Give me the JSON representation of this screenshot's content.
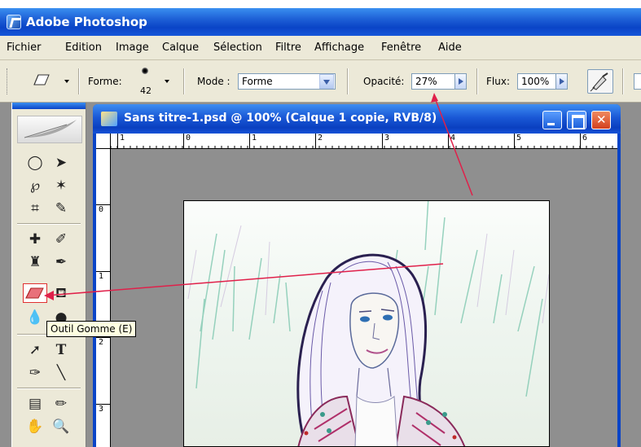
{
  "app": {
    "title": "Adobe Photoshop"
  },
  "menu": [
    "Fichier",
    "Edition",
    "Image",
    "Calque",
    "Sélection",
    "Filtre",
    "Affichage",
    "Fenêtre",
    "Aide"
  ],
  "options": {
    "forme_label": "Forme:",
    "brush_size": "42",
    "mode_label": "Mode :",
    "mode_value": "Forme",
    "opacite_label": "Opacité:",
    "opacite_value": "27%",
    "flux_label": "Flux:",
    "flux_value": "100%"
  },
  "tooltip": "Outil Gomme (E)",
  "document": {
    "title": "Sans titre-1.psd @ 100% (Calque 1 copie, RVB/8)",
    "hruler": [
      "1",
      "0",
      "1",
      "2",
      "3",
      "4",
      "5",
      "6"
    ],
    "vruler": [
      "0",
      "1",
      "2",
      "3"
    ]
  },
  "colors": {
    "title_blue": "#0a44c7",
    "panel": "#ece9d8",
    "workspace": "#8f8f8f",
    "annotation_red": "#e0204a"
  },
  "icons": {
    "toolbox": [
      "lasso-icon",
      "move-icon",
      "poly-lasso-icon",
      "magic-wand-icon",
      "crop-icon",
      "slice-icon",
      "healing-icon",
      "brush-icon",
      "stamp-icon",
      "history-brush-icon",
      "eraser-icon",
      "bucket-icon",
      "blur-icon",
      "dodge-icon",
      "path-select-icon",
      "type-icon",
      "pen-icon",
      "line-icon",
      "notes-icon",
      "eyedropper-icon",
      "hand-icon",
      "zoom-icon"
    ]
  }
}
